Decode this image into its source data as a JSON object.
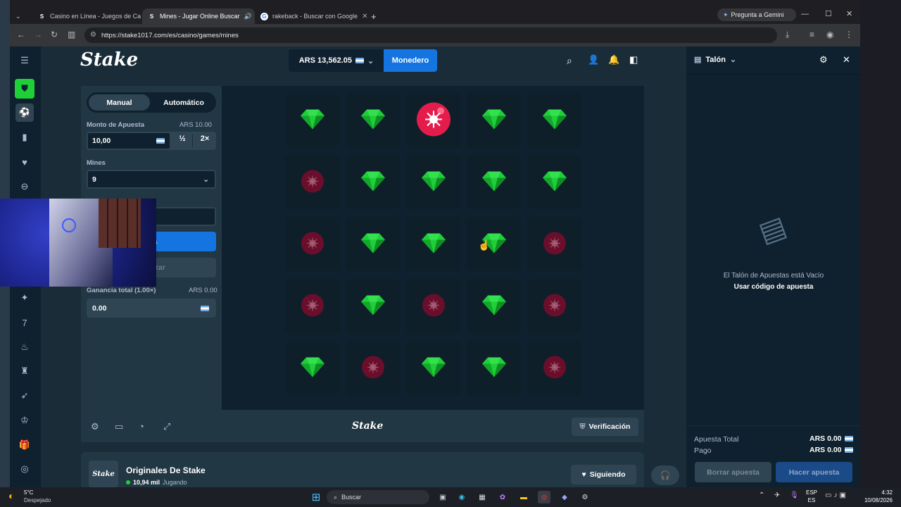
{
  "browser": {
    "tabs": [
      {
        "title": "Casino en Línea - Juegos de Ca",
        "favicon": "stake-s"
      },
      {
        "title": "Mines - Jugar Online Buscar",
        "favicon": "stake-s",
        "speaker": "speaker-icon"
      },
      {
        "title": "rakeback - Buscar con Google",
        "favicon": "google-g"
      }
    ],
    "new_tab": "+",
    "gemini": "Pregunta a Gemini",
    "url": "https://stake1017.com/es/casino/games/mines"
  },
  "header": {
    "logo": "Stake",
    "balance": "ARS 13,562.05",
    "wallet": "Monedero"
  },
  "controls": {
    "mode_manual": "Manual",
    "mode_auto": "Automático",
    "bet_label": "Monto de Apuesta",
    "bet_value_label": "ARS 10.00",
    "bet_input": "10,00",
    "half": "½",
    "double": "2×",
    "mines_label": "Mines",
    "mines_value": "9",
    "bet_button_partial": "sta",
    "random_partial": "r al azar",
    "profit_label": "Ganancia total (1.00×)",
    "profit_value_label": "ARS 0.00",
    "profit_input": "0.00"
  },
  "board": {
    "grid": [
      [
        "gem",
        "gem",
        "mine-hit",
        "gem",
        "gem"
      ],
      [
        "mine",
        "gem",
        "gem",
        "gem",
        "gem"
      ],
      [
        "mine",
        "gem",
        "gem",
        "gem",
        "mine"
      ],
      [
        "mine",
        "gem",
        "mine",
        "gem",
        "mine"
      ],
      [
        "gem",
        "mine",
        "gem",
        "gem",
        "mine"
      ]
    ]
  },
  "footer": {
    "logo": "Stake",
    "fairness": "Verificación"
  },
  "originals": {
    "title": "Originales De Stake",
    "logo": "Stake",
    "players": "10,94 mil",
    "playing": "Jugando",
    "follow": "Siguiendo"
  },
  "betslip": {
    "title": "Talón",
    "empty": "El Talón de Apuestas está Vacío",
    "code": "Usar código de apuesta",
    "total_label": "Apuesta Total",
    "total_value": "ARS 0.00",
    "payout_label": "Pago",
    "payout_value": "ARS 0.00",
    "clear": "Borrar apuesta",
    "place": "Hacer apuesta"
  },
  "taskbar": {
    "temp": "5°C",
    "weather": "Despejado",
    "search": "Buscar",
    "lang1": "ESP",
    "lang2": "ES",
    "time": "4:32",
    "date": "10/08/2026"
  },
  "colors": {
    "accent": "#1475e1",
    "gem": "#1fcf3a",
    "mine": "#e41c4b",
    "bg": "#1a2c38"
  }
}
